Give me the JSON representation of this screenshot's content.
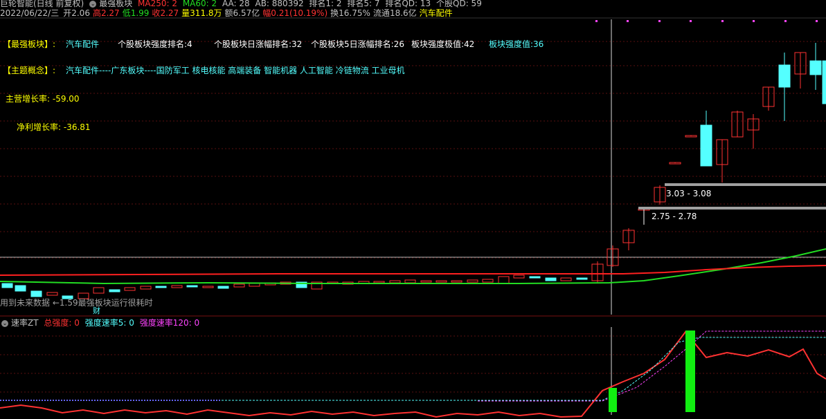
{
  "header": {
    "title": "巨轮智能(日线 前复权)",
    "indicator": "最强板块",
    "ma250": "MA250: 2",
    "ma60": "MA60: 2",
    "aa": "AA: 28",
    "ab": "AB: 880392",
    "rank1": "排名1: 2",
    "rank5": "排名5: 7",
    "rank_qd": "排名QD: 13",
    "stock_qd": "个股QD: 59"
  },
  "quote": {
    "date": "2022/06/22/三",
    "open_label": "开",
    "open": "2.06",
    "high_label": "高",
    "high": "2.27",
    "low_label": "低",
    "low": "1.99",
    "close_label": "收",
    "close": "2.27",
    "vol_label": "量",
    "vol": "311.8万",
    "amount_label": "额",
    "amount": "6.57亿",
    "change_label": "幅",
    "change": "0.21(10.19%)",
    "turnover_label": "换",
    "turnover": "16.75%",
    "float_label": "流通",
    "float": "18.6亿",
    "sector": "汽车配件"
  },
  "panel": {
    "strongest_label": "【最强板块】:",
    "strongest_value": "汽车配件",
    "stock_rank": "个股板块强度排名:4",
    "day_rank": "个股板块日涨幅排名:32",
    "day5_rank": "个股板块5日涨幅排名:26",
    "extreme": "板块强度极值:42",
    "strength": "板块强度值:36",
    "concept_label": "【主题概念】:",
    "concept_value": "汽车配件----广东板块----国防军工 核电核能 高端装备 智能机器 人工智能 冷链物流 工业母机",
    "revenue_growth": "主营增长率: -59.00",
    "profit_growth": "净利增长率: -36.81"
  },
  "annotations": {
    "price_upper": "3.03 - 3.08",
    "price_lower": "2.75 - 2.78",
    "warning": "用到未来数据 ←1.59",
    "warning2": "最强板块运行很耗时",
    "finance_mark": "财"
  },
  "sub": {
    "name": "速率ZT",
    "total": "总强度: 0",
    "s5": "强度速率5: 0",
    "s120": "强度速率120: 0"
  },
  "colors": {
    "up": "#ff3232",
    "down": "#54ffff",
    "ma60": "#22dd22",
    "ma250": "#ff2020",
    "label_yellow": "#ffff00",
    "label_cyan": "#5ad7ff",
    "magenta": "#ff44ff"
  }
}
